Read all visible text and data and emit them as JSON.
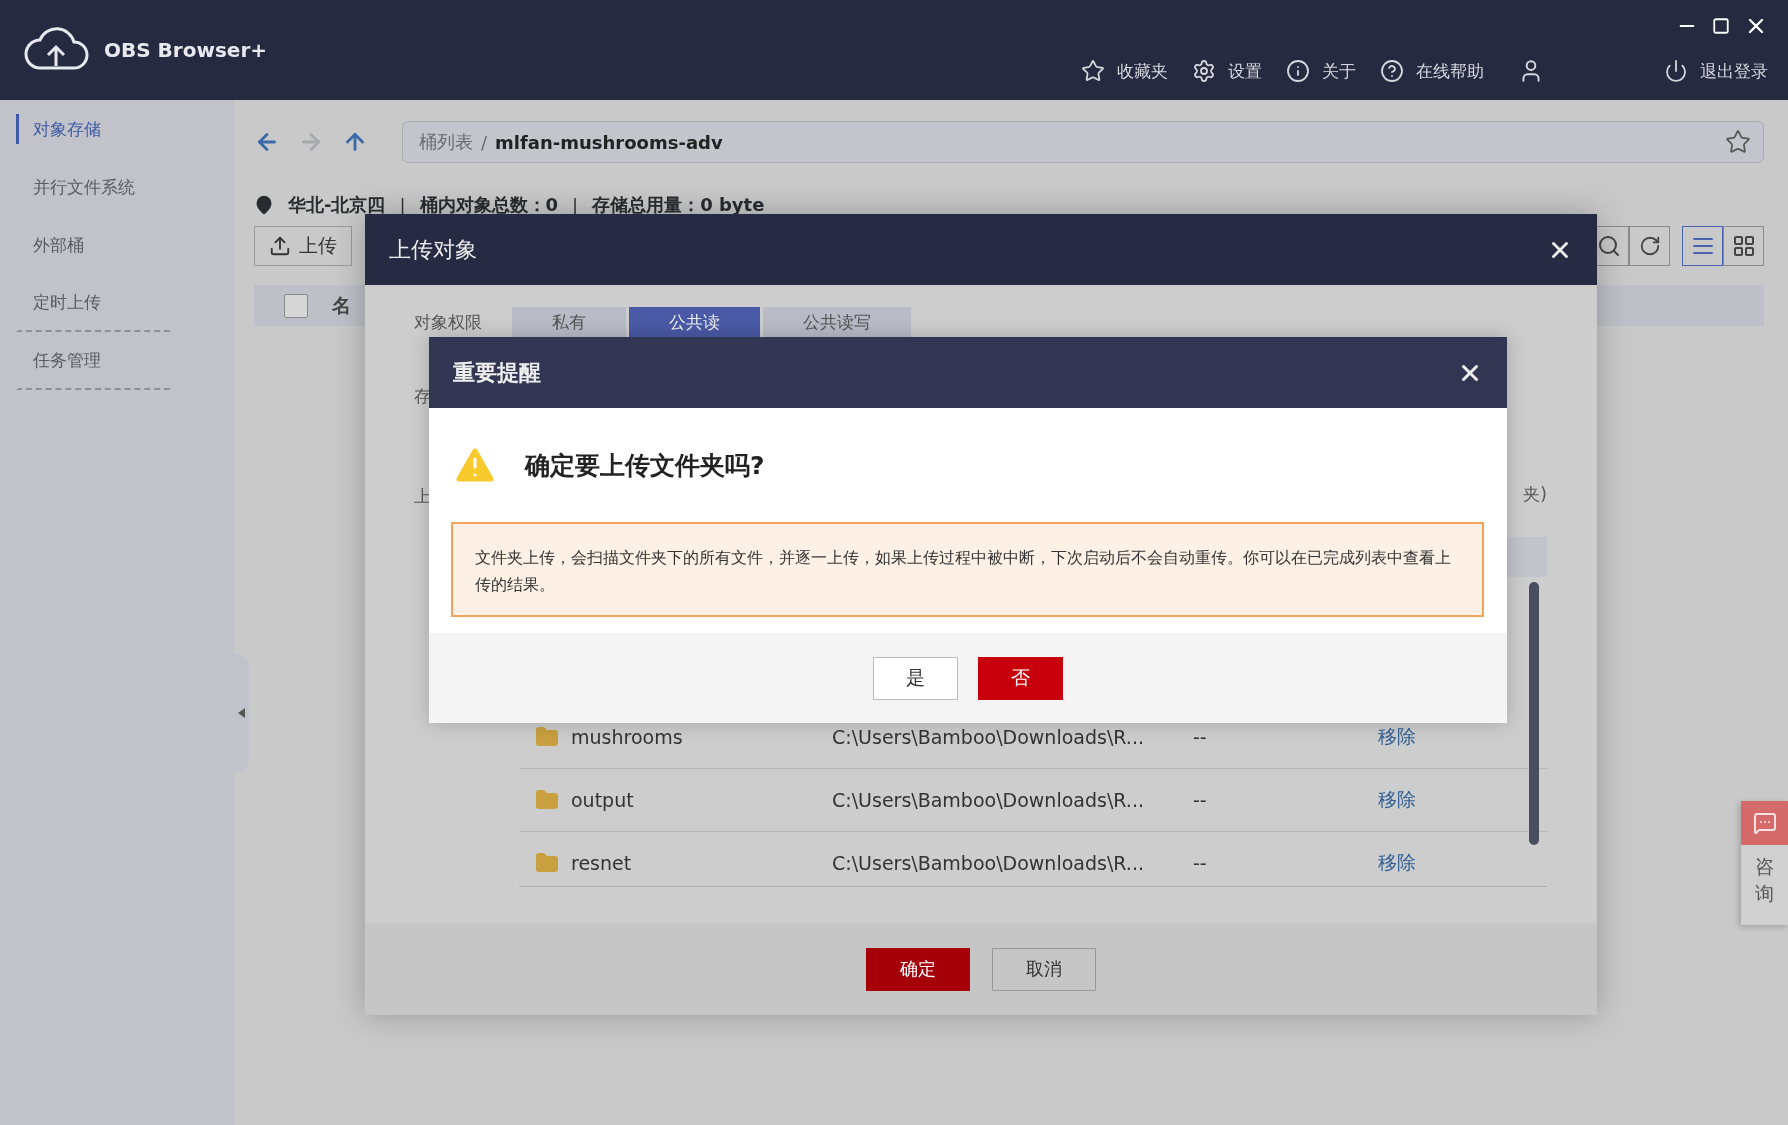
{
  "app": {
    "title": "OBS Browser+"
  },
  "window_controls": [
    {
      "kind": "minimize"
    },
    {
      "kind": "maximize"
    },
    {
      "kind": "close"
    }
  ],
  "top_nav": [
    {
      "kind": "favorites",
      "label": "收藏夹"
    },
    {
      "kind": "settings",
      "label": "设置"
    },
    {
      "kind": "about",
      "label": "关于"
    },
    {
      "kind": "help",
      "label": "在线帮助"
    },
    {
      "kind": "user"
    },
    {
      "kind": "logout",
      "label": "退出登录"
    }
  ],
  "sidebar": {
    "items": [
      {
        "label": "对象存储",
        "selected": true
      },
      {
        "label": "并行文件系统",
        "selected": false
      },
      {
        "label": "外部桶",
        "selected": false
      },
      {
        "label": "定时上传",
        "selected": false
      },
      {
        "label": "任务管理",
        "selected": false
      }
    ]
  },
  "breadcrumb": {
    "root": "桶列表",
    "separator": "/",
    "current": "mlfan-mushrooms-adv"
  },
  "info": {
    "region": "华北-北京四",
    "separator": "|",
    "object_count": "桶内对象总数：0",
    "storage": "存储总用量：0 byte"
  },
  "toolbar": {
    "upload": "上传",
    "views": [
      {
        "kind": "list",
        "selected": true
      },
      {
        "kind": "grid",
        "selected": false
      }
    ]
  },
  "table": {
    "select_all_checked": false,
    "columns": [
      "名"
    ]
  },
  "upload_dialog": {
    "title": "上传对象",
    "permission_label": "对象权限",
    "permission_tabs": [
      {
        "label": "私有",
        "selected": false
      },
      {
        "label": "公共读",
        "selected": true
      },
      {
        "label": "公共读写",
        "selected": false
      }
    ],
    "storage_label": "存",
    "upload_label": "上",
    "note_tail": "夹)",
    "files": [
      {
        "name": "mushrooms",
        "path": "C:\\Users\\Bamboo\\Downloads\\R...",
        "size": "--",
        "action": "移除"
      },
      {
        "name": "output",
        "path": "C:\\Users\\Bamboo\\Downloads\\R...",
        "size": "--",
        "action": "移除"
      },
      {
        "name": "resnet",
        "path": "C:\\Users\\Bamboo\\Downloads\\R...",
        "size": "--",
        "action": "移除"
      }
    ],
    "confirm": "确定",
    "cancel": "取消"
  },
  "alert_dialog": {
    "title": "重要提醒",
    "question": "确定要上传文件夹吗?",
    "message": "文件夹上传，会扫描文件夹下的所有文件，并逐一上传，如果上传过程中被中断，下次启动后不会自动重传。你可以在已完成列表中查看上传的结果。",
    "yes": "是",
    "no": "否"
  },
  "consult": {
    "label": "咨询"
  }
}
